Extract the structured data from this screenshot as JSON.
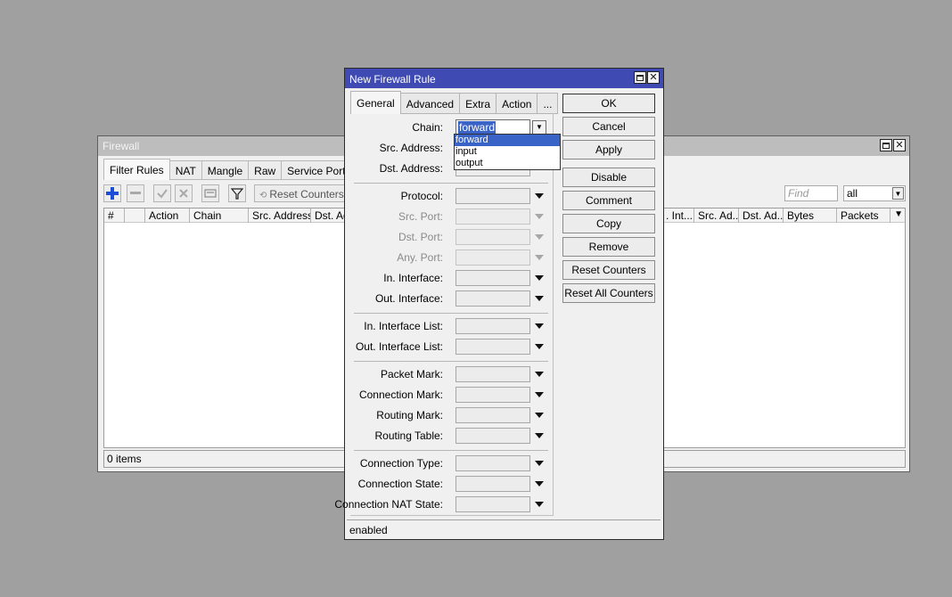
{
  "firewall": {
    "title": "Firewall",
    "tabs": [
      "Filter Rules",
      "NAT",
      "Mangle",
      "Raw",
      "Service Ports"
    ],
    "toolbar": {
      "reset_counters": "Reset Counters",
      "find_placeholder": "Find",
      "filter_value": "all"
    },
    "columns": [
      "#",
      "",
      "Action",
      "Chain",
      "Src. Address",
      "Dst. Address",
      ". Int...",
      "Src. Ad...",
      "Dst. Ad...",
      "Bytes",
      "Packets"
    ],
    "status": "0 items"
  },
  "dialog": {
    "title": "New Firewall Rule",
    "tabs": [
      "General",
      "Advanced",
      "Extra",
      "Action",
      "..."
    ],
    "fields": {
      "chain": {
        "label": "Chain:",
        "value": "forward"
      },
      "src_address": "Src. Address:",
      "dst_address": "Dst. Address:",
      "protocol": "Protocol:",
      "src_port": "Src. Port:",
      "dst_port": "Dst. Port:",
      "any_port": "Any. Port:",
      "in_interface": "In. Interface:",
      "out_interface": "Out. Interface:",
      "in_interface_list": "In. Interface List:",
      "out_interface_list": "Out. Interface List:",
      "packet_mark": "Packet Mark:",
      "connection_mark": "Connection Mark:",
      "routing_mark": "Routing Mark:",
      "routing_table": "Routing Table:",
      "connection_type": "Connection Type:",
      "connection_state": "Connection State:",
      "connection_nat_state": "Connection NAT State:"
    },
    "chain_options": [
      "forward",
      "input",
      "output"
    ],
    "buttons": {
      "ok": "OK",
      "cancel": "Cancel",
      "apply": "Apply",
      "disable": "Disable",
      "comment": "Comment",
      "copy": "Copy",
      "remove": "Remove",
      "reset_counters": "Reset Counters",
      "reset_all_counters": "Reset All Counters"
    },
    "status": "enabled"
  },
  "colors": {
    "dialog_title": "#3f4bb3",
    "selection": "#3a63c7",
    "add_icon": "#1b4fd6"
  }
}
